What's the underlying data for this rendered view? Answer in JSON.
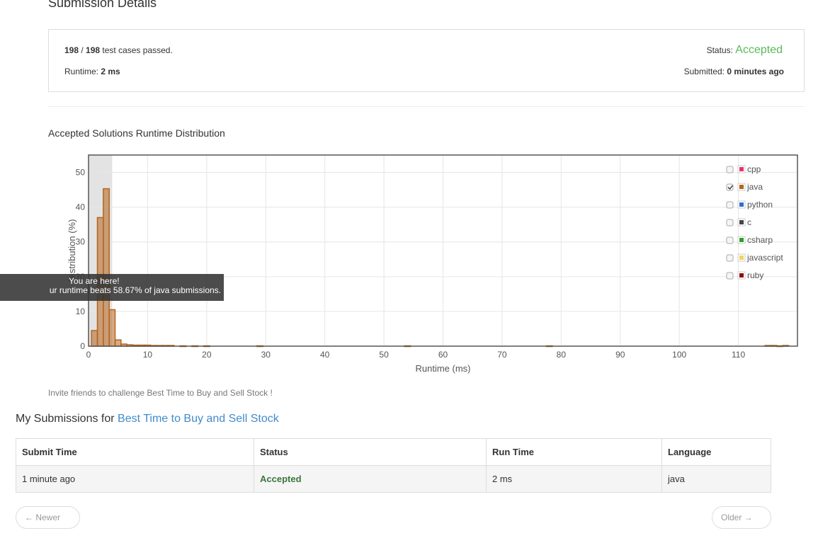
{
  "header": {
    "title": "Submission Details"
  },
  "summary": {
    "passed": "198",
    "total": "198",
    "passed_suffix": " test cases passed.",
    "runtime_label": "Runtime: ",
    "runtime_value": "2 ms",
    "status_label": "Status: ",
    "status_value": "Accepted",
    "submitted_label": "Submitted: ",
    "submitted_value": "0 minutes ago"
  },
  "chart_title": "Accepted Solutions Runtime Distribution",
  "tooltip": {
    "line1": "You are here!",
    "line2": "ur runtime beats 58.67% of java submissions."
  },
  "chart_data": {
    "type": "bar",
    "title": "Accepted Solutions Runtime Distribution",
    "xlabel": "Runtime (ms)",
    "ylabel": "Distribution (%)",
    "xlim": [
      0,
      120
    ],
    "ylim": [
      0,
      55
    ],
    "xticks": [
      0,
      10,
      20,
      30,
      40,
      50,
      60,
      70,
      80,
      90,
      100,
      110
    ],
    "yticks": [
      0,
      10,
      20,
      30,
      40,
      50
    ],
    "grid": true,
    "legend_position": "top-right",
    "highlight_range": [
      0,
      4
    ],
    "series": [
      {
        "name": "java",
        "color": "#b5651d",
        "x": [
          1,
          2,
          3,
          4,
          5,
          6,
          7,
          8,
          9,
          10,
          11,
          12,
          13,
          14,
          16,
          18,
          20,
          29,
          54,
          78,
          115,
          116,
          117,
          118
        ],
        "values": [
          4.5,
          37,
          45.3,
          10.5,
          1.8,
          0.6,
          0.4,
          0.3,
          0.3,
          0.3,
          0.2,
          0.2,
          0.2,
          0.2,
          0.1,
          0.1,
          0.1,
          0.1,
          0.1,
          0.1,
          0.2,
          0.2,
          0.1,
          0.2
        ]
      }
    ],
    "legend": [
      {
        "name": "cpp",
        "color": "#e8336f",
        "checked": false
      },
      {
        "name": "java",
        "color": "#b5651d",
        "checked": true
      },
      {
        "name": "python",
        "color": "#2f6dd0",
        "checked": false
      },
      {
        "name": "c",
        "color": "#444444",
        "checked": false
      },
      {
        "name": "csharp",
        "color": "#2ca02c",
        "checked": false
      },
      {
        "name": "javascript",
        "color": "#f4d35e",
        "checked": false
      },
      {
        "name": "ruby",
        "color": "#8b0f0f",
        "checked": false
      }
    ]
  },
  "invite": "Invite friends to challenge Best Time to Buy and Sell Stock !",
  "my_submissions": {
    "prefix": "My Submissions for ",
    "problem_link": "Best Time to Buy and Sell Stock",
    "columns": [
      "Submit Time",
      "Status",
      "Run Time",
      "Language"
    ],
    "rows": [
      {
        "submit_time": "1 minute ago",
        "status": "Accepted",
        "run_time": "2 ms",
        "language": "java"
      }
    ]
  },
  "pager": {
    "newer": "← Newer",
    "older": "Older →"
  }
}
